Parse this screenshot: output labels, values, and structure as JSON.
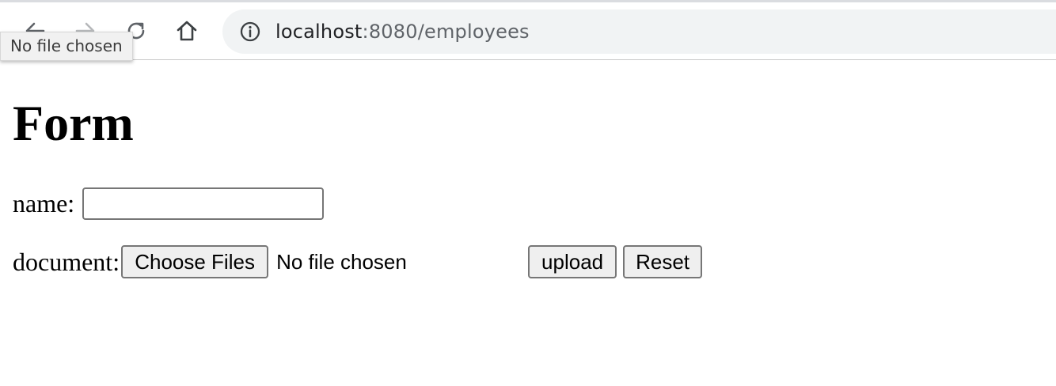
{
  "browser": {
    "url_host": "localhost",
    "url_path": ":8080/employees",
    "icons": {
      "back": "back-arrow-icon",
      "forward": "forward-arrow-icon",
      "reload": "reload-icon",
      "home": "home-icon",
      "info": "info-icon"
    },
    "tooltip": "No file chosen"
  },
  "form": {
    "title": "Form",
    "name_label": "name:",
    "name_value": "",
    "document_label": "document:",
    "choose_files_label": "Choose Files",
    "file_status": "No file chosen",
    "upload_label": "upload",
    "reset_label": "Reset"
  },
  "colors": {
    "omnibox_bg": "#f1f3f4",
    "button_bg": "#efefef",
    "button_border": "#767676",
    "url_path": "#5f6368"
  }
}
